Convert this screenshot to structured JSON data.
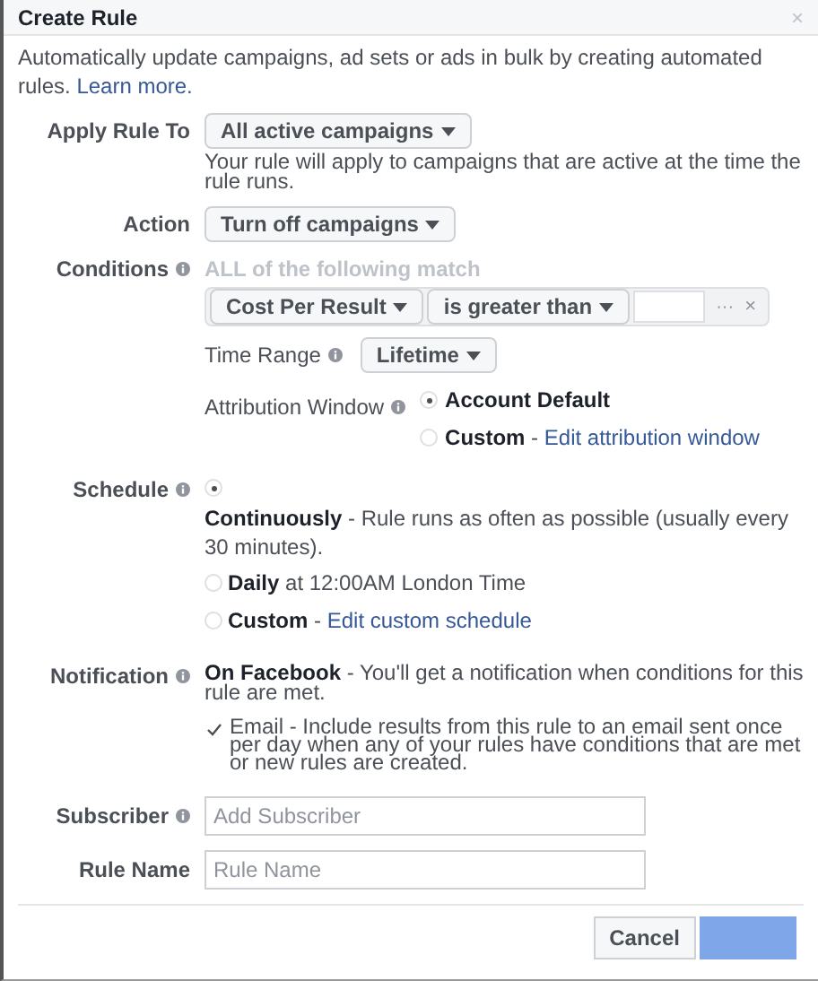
{
  "dialog": {
    "title": "Create Rule",
    "close": "×"
  },
  "intro": {
    "text": "Automatically update campaigns, ad sets or ads in bulk by creating automated rules.",
    "link": "Learn more."
  },
  "apply_rule_to": {
    "label": "Apply Rule To",
    "value": "All active campaigns",
    "help": "Your rule will apply to campaigns that are active at the time the rule runs."
  },
  "action": {
    "label": "Action",
    "value": "Turn off campaigns"
  },
  "conditions": {
    "label": "Conditions",
    "heading": "ALL of the following match",
    "metric": "Cost Per Result",
    "operator": "is greater than",
    "more": "···",
    "remove": "×"
  },
  "time_range": {
    "label": "Time Range",
    "value": "Lifetime"
  },
  "attribution_window": {
    "label": "Attribution Window",
    "options": [
      {
        "title": "Account Default",
        "selected": true
      },
      {
        "title": "Custom",
        "text": " - ",
        "link": "Edit attribution window",
        "selected": false
      }
    ]
  },
  "schedule": {
    "label": "Schedule",
    "options": [
      {
        "title": "Continuously",
        "text": " - Rule runs as often as possible (usually every 30 minutes).",
        "selected": true
      },
      {
        "title": "Daily",
        "text": " at 12:00AM London Time",
        "selected": false
      },
      {
        "title": "Custom",
        "text": " - ",
        "link": "Edit custom schedule",
        "selected": false
      }
    ]
  },
  "notification": {
    "label": "Notification",
    "title": "On Facebook",
    "text": " - You'll get a notification when conditions for this rule are met.",
    "email": {
      "text": "Email - Include results from this rule to an email sent once per day when any of your rules have conditions that are met or new rules are created.",
      "checked": true
    }
  },
  "subscriber": {
    "label": "Subscriber",
    "placeholder": "Add Subscriber"
  },
  "rule_name": {
    "label": "Rule Name",
    "placeholder": "Rule Name"
  },
  "buttons": [
    {
      "label": "Cancel",
      "kind": "secondary"
    },
    {
      "kind": "primary"
    }
  ]
}
